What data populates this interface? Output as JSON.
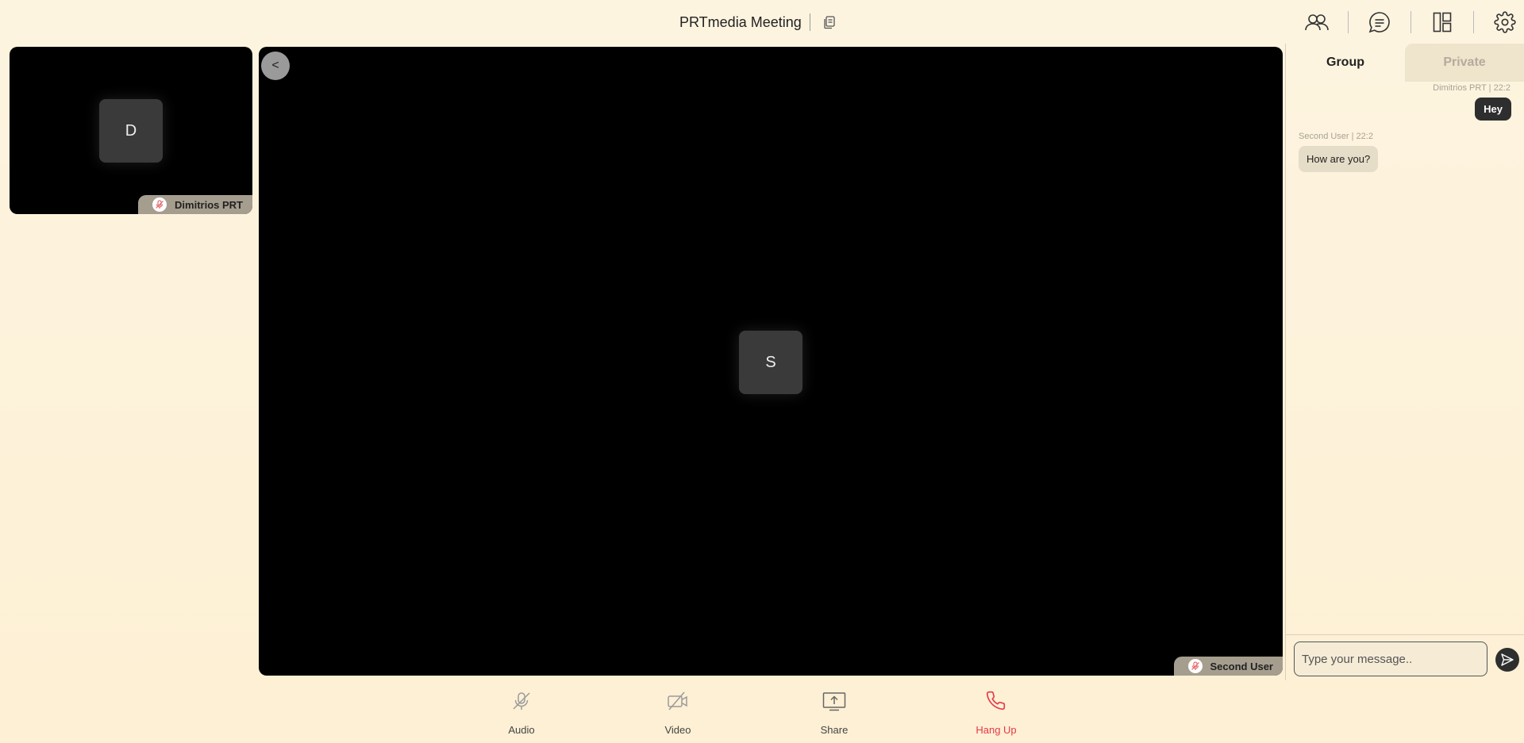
{
  "header": {
    "title": "PRTmedia Meeting",
    "icons": [
      "copy-icon",
      "participants-icon",
      "chat-icon",
      "layout-icon",
      "settings-icon"
    ]
  },
  "participants": {
    "self": {
      "initial": "D",
      "name": "Dimitrios PRT",
      "muted": true
    },
    "main": {
      "initial": "S",
      "name": "Second User",
      "muted": true
    }
  },
  "stage": {
    "collapse_label": "<"
  },
  "chat": {
    "tabs": {
      "group": "Group",
      "private": "Private"
    },
    "messages": [
      {
        "meta": "Dimitrios PRT | 22:2",
        "text": "Hey",
        "mine": true
      },
      {
        "meta": "Second User | 22:2",
        "text": "How are you?",
        "mine": false
      }
    ],
    "input_placeholder": "Type your message.."
  },
  "controls": {
    "audio": "Audio",
    "video": "Video",
    "share": "Share",
    "hangup": "Hang Up"
  },
  "colors": {
    "background": "#fdf4e0",
    "accent_dark": "#2e2e2e",
    "hangup_red": "#e53946",
    "muted_red": "#e56a6a"
  }
}
